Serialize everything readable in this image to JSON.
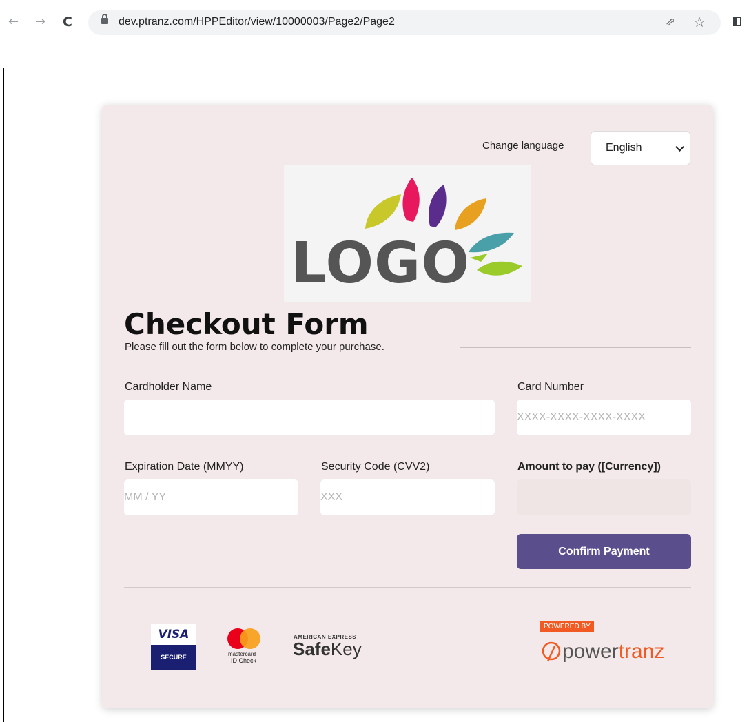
{
  "browser": {
    "url": "dev.ptranz.com/HPPEditor/view/10000003/Page2/Page2"
  },
  "language": {
    "label": "Change language",
    "selected": "English"
  },
  "logo": {
    "text": "LOGO",
    "colors": [
      "#c8c82a",
      "#e8185e",
      "#5a2d8c",
      "#e8a020",
      "#4aa0a8",
      "#9acb2a"
    ]
  },
  "form": {
    "title": "Checkout Form",
    "subtitle": "Please fill out the form below to complete your purchase.",
    "cardholder_name": {
      "label": "Cardholder Name",
      "value": "",
      "placeholder": ""
    },
    "card_number": {
      "label": "Card Number",
      "placeholder": "XXXX-XXXX-XXXX-XXXX"
    },
    "expiration": {
      "label": "Expiration Date (MMYY)",
      "placeholder": "MM / YY"
    },
    "cvv": {
      "label": "Security Code (CVV2)",
      "placeholder": "XXX"
    },
    "amount": {
      "label": "Amount to pay ([Currency])",
      "value": ""
    },
    "confirm_label": "Confirm Payment"
  },
  "badges": {
    "visa_top": "VISA",
    "visa_bottom": "SECURE",
    "mastercard_line1": "mastercard",
    "mastercard_line2": "ID Check",
    "amex_top": "AMERICAN EXPRESS",
    "amex_bold": "Safe",
    "amex_light": "Key",
    "powered_by": "POWERED BY",
    "powertranz_a": "power",
    "powertranz_b": "tranz"
  },
  "colors": {
    "accent": "#5b4e8c",
    "card_background": "#f4e9ea",
    "powertranz_orange": "#f15a22"
  }
}
